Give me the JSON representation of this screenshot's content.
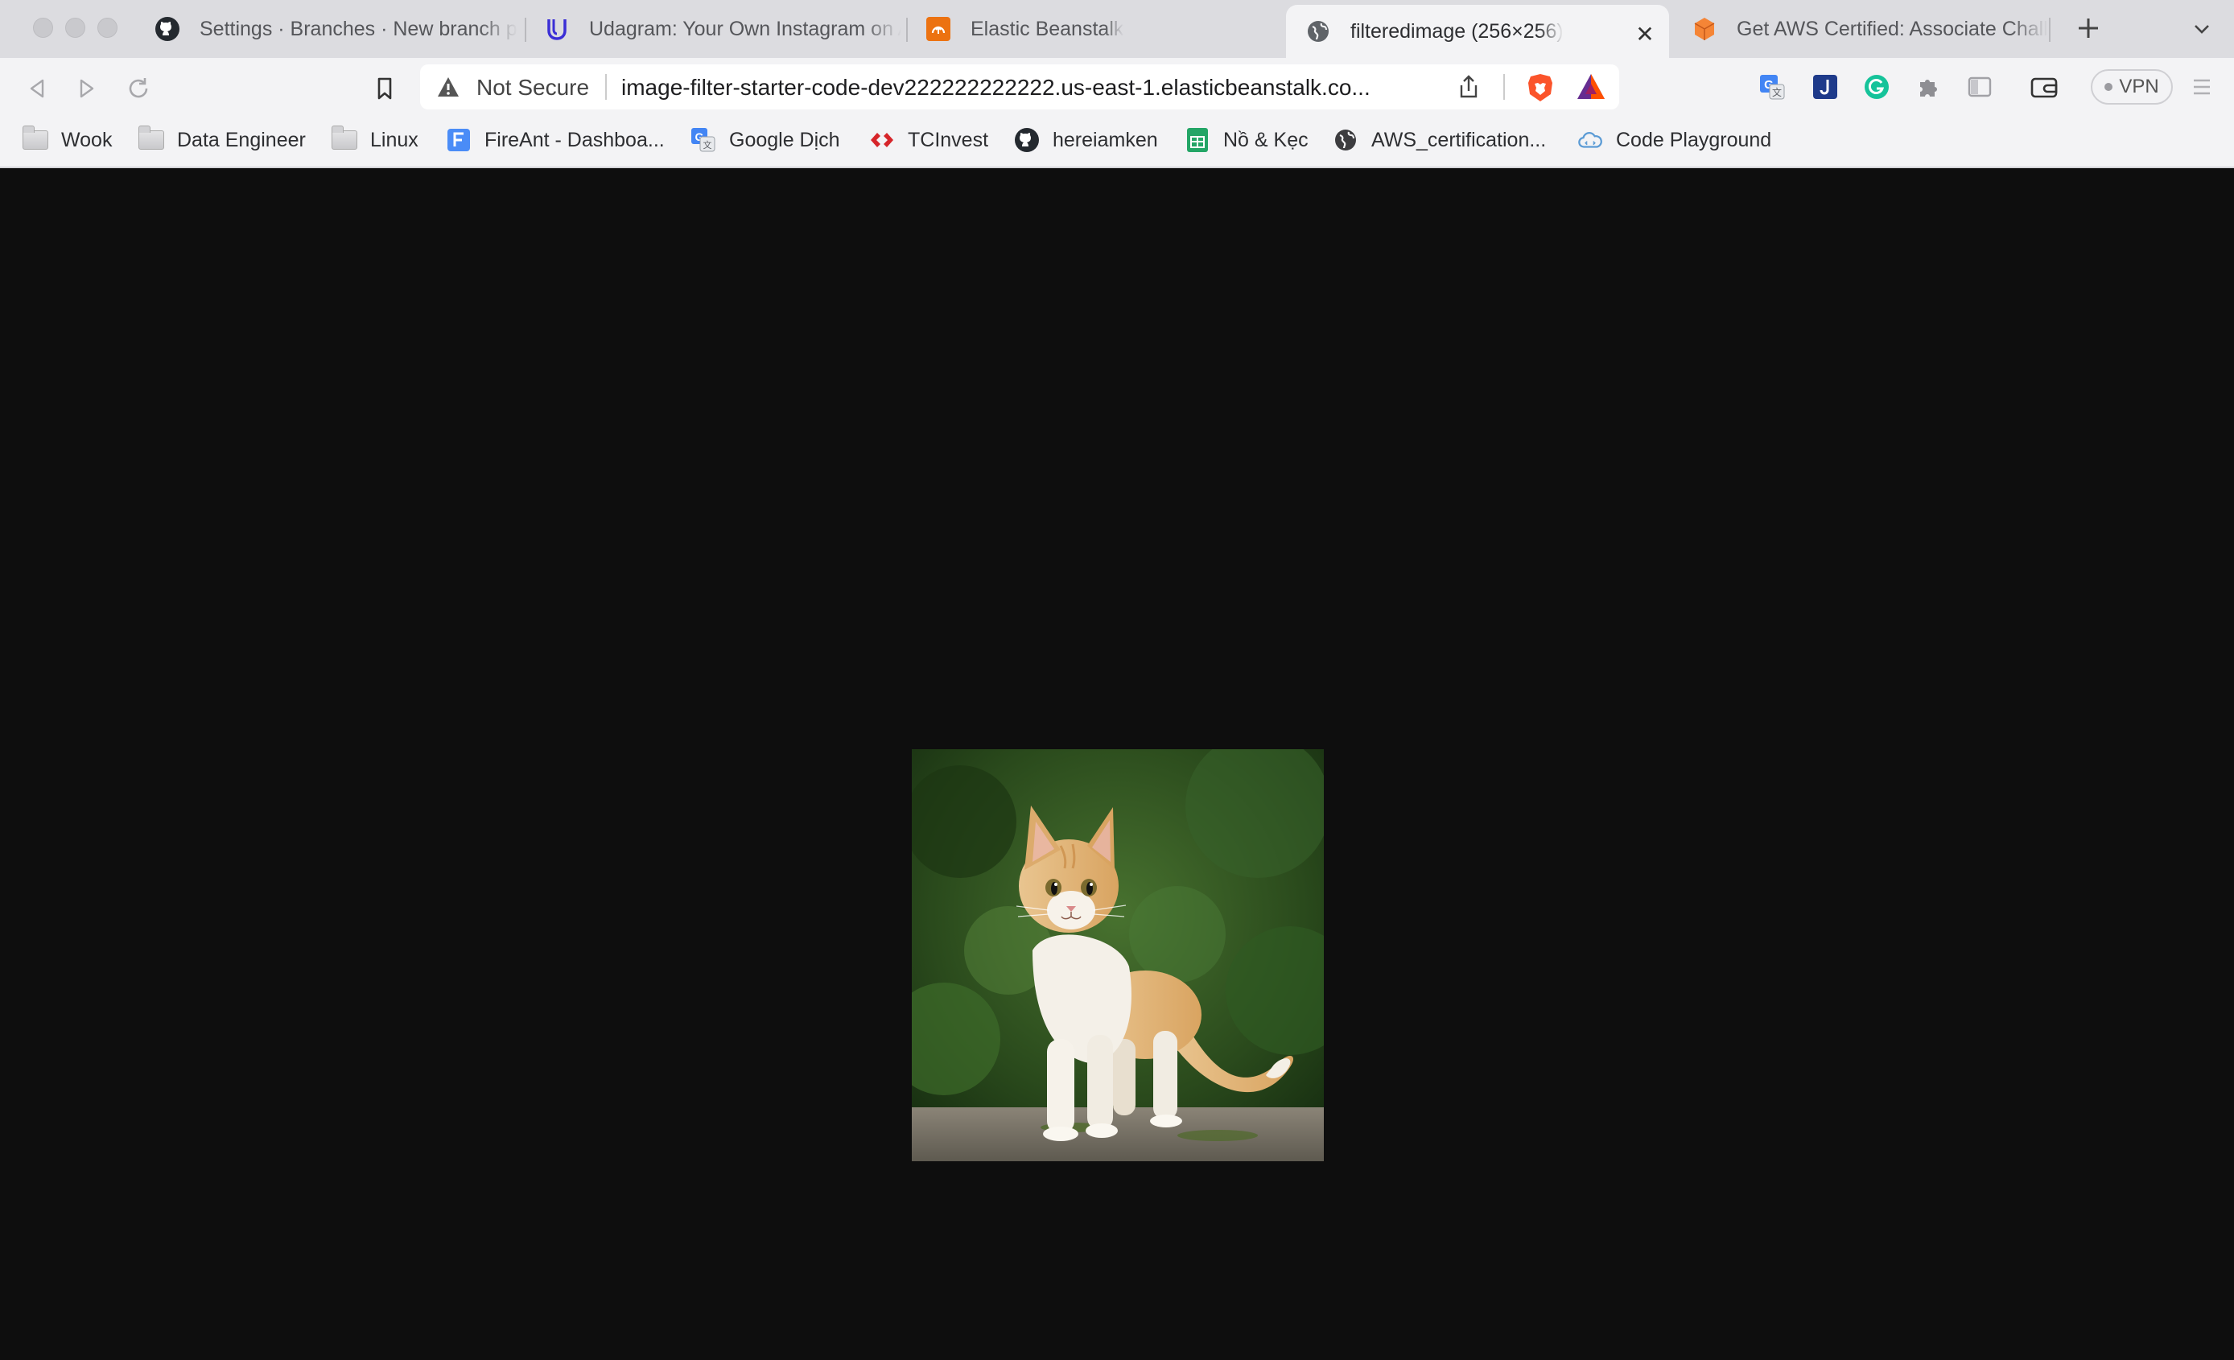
{
  "browser": {
    "tabs": [
      {
        "title": "Settings · Branches · New branch p",
        "icon": "github-icon",
        "active": false
      },
      {
        "title": "Udagram: Your Own Instagram on A",
        "icon": "udacity-icon",
        "active": false
      },
      {
        "title": "Elastic Beanstalk",
        "icon": "aws-elastic-beanstalk-icon",
        "active": false
      },
      {
        "title": "filteredimage (256×256)",
        "icon": "globe-icon",
        "active": true
      },
      {
        "title": "Get AWS Certified: Associate Chall",
        "icon": "aws-cube-icon",
        "active": false
      }
    ],
    "address_bar": {
      "security_label": "Not Secure",
      "url": "image-filter-starter-code-dev222222222222.us-east-1.elasticbeanstalk.co..."
    },
    "vpn_label": "VPN",
    "bookmarks": [
      {
        "label": "Wook",
        "icon": "folder-icon"
      },
      {
        "label": "Data Engineer",
        "icon": "folder-icon"
      },
      {
        "label": "Linux",
        "icon": "folder-icon"
      },
      {
        "label": "FireAnt - Dashboa...",
        "icon": "fireant-icon"
      },
      {
        "label": "Google Dịch",
        "icon": "google-translate-icon"
      },
      {
        "label": "TCInvest",
        "icon": "tcinvest-icon"
      },
      {
        "label": "hereiamken",
        "icon": "github-icon"
      },
      {
        "label": "Nồ & Kẹc",
        "icon": "google-sheets-icon"
      },
      {
        "label": "AWS_certification...",
        "icon": "globe-icon"
      },
      {
        "label": "Code Playground",
        "icon": "cloud-icon"
      }
    ],
    "colors": {
      "page_background": "#0e0e0e",
      "chrome_background": "#f3f3f5",
      "tabstrip_background": "#dcdce0"
    }
  },
  "page": {
    "image": {
      "subject": "orange and white kitten on stone ledge",
      "natural_size": "256×256"
    }
  }
}
